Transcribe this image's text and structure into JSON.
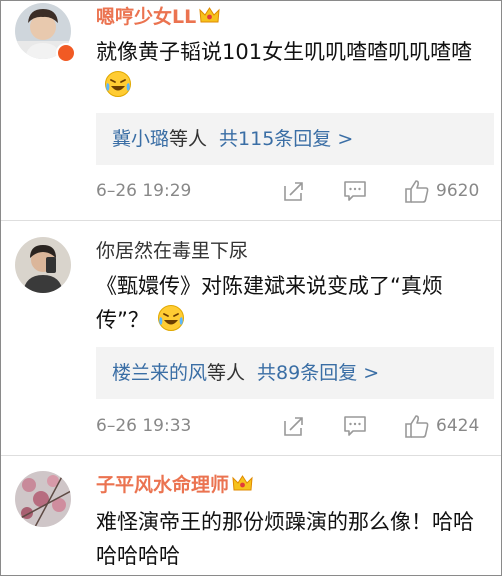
{
  "comments": [
    {
      "username": "嗯哼少女LL",
      "text": "就像黄子韬说101女生叽叽喳喳叽叽喳喳",
      "reply": {
        "users": "冀小璐",
        "suffix": "等人",
        "count_label": "共115条回复 >"
      },
      "timestamp": "6–26 19:29",
      "likes": "9620"
    },
    {
      "username": "你居然在毒里下尿",
      "text": "《甄嬛传》对陈建斌来说变成了“真烦传”？",
      "reply": {
        "users": "楼兰来的风",
        "suffix": "等人",
        "count_label": "共89条回复 >"
      },
      "timestamp": "6–26 19:33",
      "likes": "6424"
    },
    {
      "username": "子平风水命理师",
      "text": "难怪演帝王的那份烦躁演的那么像！哈哈哈哈哈哈"
    }
  ],
  "icons": {
    "crown": "crown-badge-icon",
    "emoji": "laughing-tears-emoji-icon",
    "share": "share-icon",
    "comment": "comment-icon",
    "like": "thumbs-up-icon"
  },
  "colors": {
    "username_orange": "#eb7350",
    "link_blue": "#3a6ea5",
    "meta_gray": "#888888",
    "reply_bg": "#f3f3f3"
  }
}
